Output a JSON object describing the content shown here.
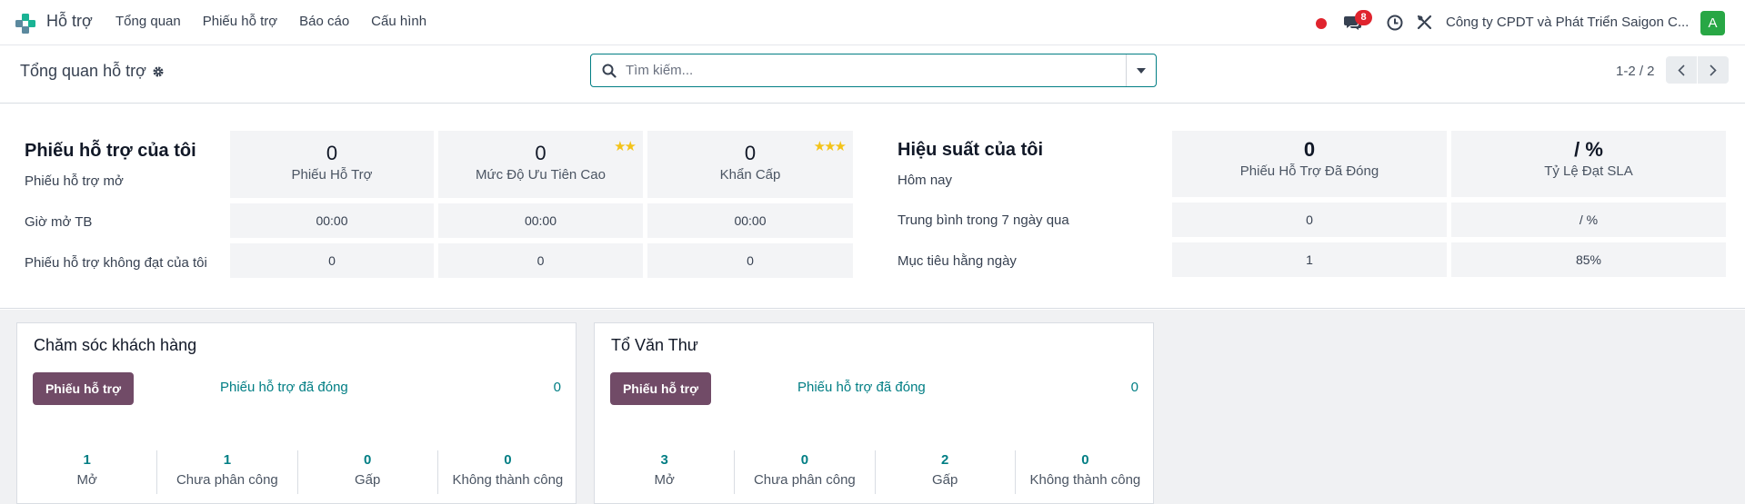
{
  "navbar": {
    "app_name": "Hỗ trợ",
    "menu": [
      "Tổng quan",
      "Phiếu hỗ trợ",
      "Báo cáo",
      "Cấu hình"
    ],
    "message_count": "8",
    "company": "Công ty CPDT và Phát Triển Saigon C...",
    "avatar_letter": "A",
    "avatar_color": "#28a745"
  },
  "control": {
    "breadcrumb": "Tổng quan hỗ trợ",
    "search_placeholder": "Tìm kiếm...",
    "pager": "1-2 / 2"
  },
  "my_tickets": {
    "title": "Phiếu hỗ trợ của tôi",
    "row_labels": [
      "Phiếu hỗ trợ mở",
      "Giờ mở TB",
      "Phiếu hỗ trợ không đạt của tôi"
    ],
    "columns": [
      {
        "count": "0",
        "label": "Phiếu Hỗ Trợ",
        "stars": "",
        "avg_hours": "00:00",
        "failed": "0"
      },
      {
        "count": "0",
        "label": "Mức Độ Ưu Tiên Cao",
        "stars": "★★",
        "avg_hours": "00:00",
        "failed": "0"
      },
      {
        "count": "0",
        "label": "Khẩn Cấp",
        "stars": "★★★",
        "avg_hours": "00:00",
        "failed": "0"
      }
    ]
  },
  "performance": {
    "title": "Hiệu suất của tôi",
    "row_labels": [
      "Hôm nay",
      "Trung bình trong 7 ngày qua",
      "Mục tiêu hằng ngày"
    ],
    "columns": [
      {
        "today": "0",
        "label": "Phiếu Hỗ Trợ Đã Đóng",
        "avg7": "0",
        "target": "1"
      },
      {
        "today": "/ %",
        "label": "Tỷ Lệ Đạt SLA",
        "avg7": "/ %",
        "target": "85%"
      }
    ]
  },
  "teams": [
    {
      "name": "Chăm sóc khách hàng",
      "button": "Phiếu hỗ trợ",
      "closed_label": "Phiếu hỗ trợ đã đóng",
      "closed_count": "0",
      "metrics": [
        {
          "value": "1",
          "label": "Mở"
        },
        {
          "value": "1",
          "label": "Chưa phân công"
        },
        {
          "value": "0",
          "label": "Gấp"
        },
        {
          "value": "0",
          "label": "Không thành công"
        }
      ]
    },
    {
      "name": "Tổ Văn Thư",
      "button": "Phiếu hỗ trợ",
      "closed_label": "Phiếu hỗ trợ đã đóng",
      "closed_count": "0",
      "metrics": [
        {
          "value": "3",
          "label": "Mở"
        },
        {
          "value": "0",
          "label": "Chưa phân công"
        },
        {
          "value": "2",
          "label": "Gấp"
        },
        {
          "value": "0",
          "label": "Không thành công"
        }
      ]
    }
  ],
  "colors": {
    "primary": "#714b67",
    "accent": "#017e84",
    "badge": "#e0242e",
    "star": "#f3c319"
  }
}
